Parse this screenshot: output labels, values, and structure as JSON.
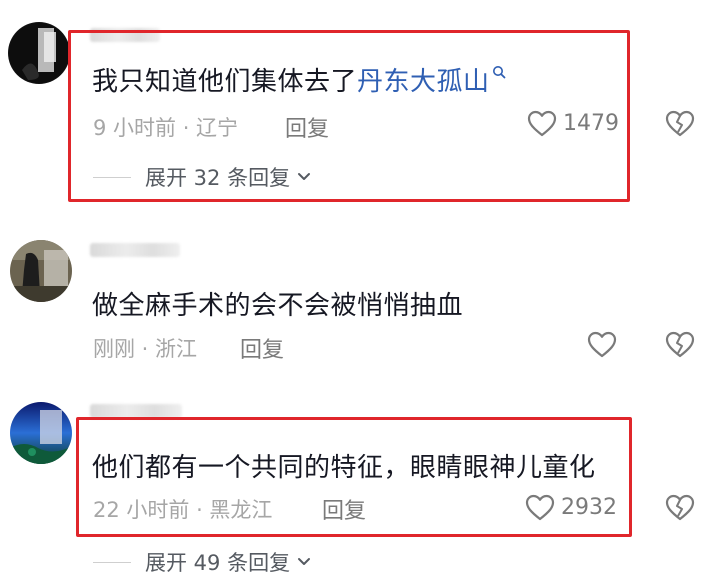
{
  "comments": [
    {
      "text": "我只知道他们集体去了",
      "link": "丹东大孤山",
      "meta": "9 小时前 · 辽宁",
      "reply": "回复",
      "likes": "1479",
      "expand": "展开 32 条回复"
    },
    {
      "text": "做全麻手术的会不会被悄悄抽血",
      "meta": "刚刚 · 浙江",
      "reply": "回复"
    },
    {
      "text": "他们都有一个共同的特征，眼睛眼神儿童化",
      "meta": "22 小时前 · 黑龙江",
      "reply": "回复",
      "likes": "2932",
      "expand": "展开 49 条回复"
    }
  ],
  "colors": {
    "highlight": "#e0262b",
    "link": "#2f5fb3"
  }
}
